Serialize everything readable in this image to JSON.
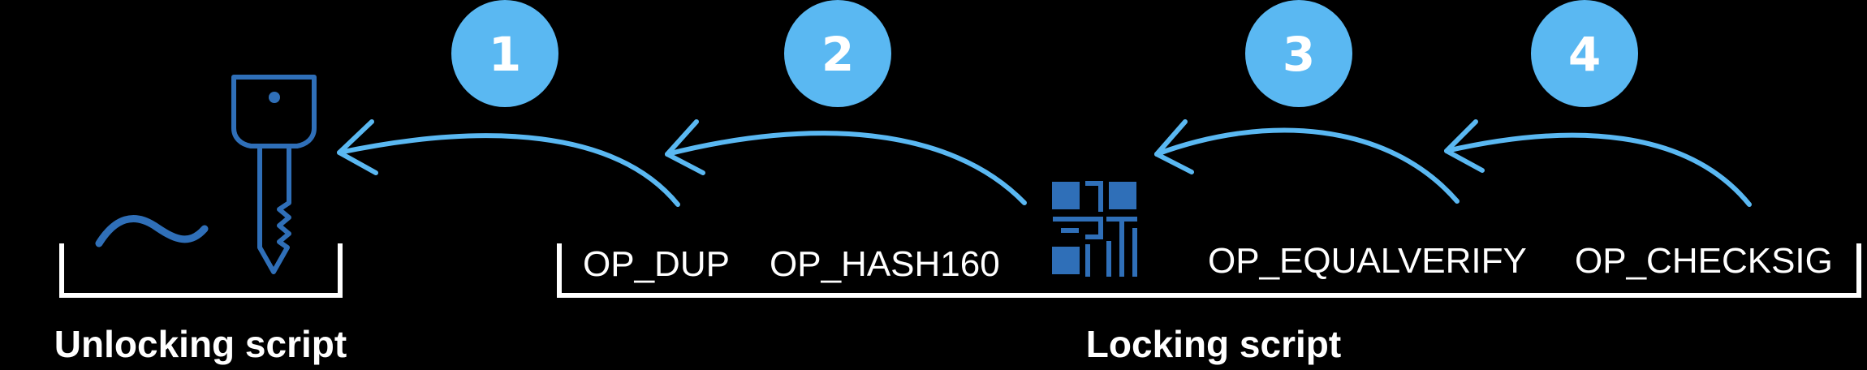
{
  "colors": {
    "background": "#000000",
    "arrow": "#5ab8f2",
    "badge": "#5ab8f2",
    "icon": "#2f6fb8",
    "text": "#ffffff"
  },
  "steps": [
    {
      "number": "1"
    },
    {
      "number": "2"
    },
    {
      "number": "3"
    },
    {
      "number": "4"
    }
  ],
  "unlocking": {
    "label": "Unlocking script",
    "icons": [
      "key-icon",
      "signature-icon"
    ]
  },
  "locking": {
    "label": "Locking script",
    "ops": [
      "OP_DUP",
      "OP_HASH160",
      "OP_EQUALVERIFY",
      "OP_CHECKSIG"
    ],
    "icons": [
      "public-key-hash-icon"
    ]
  }
}
